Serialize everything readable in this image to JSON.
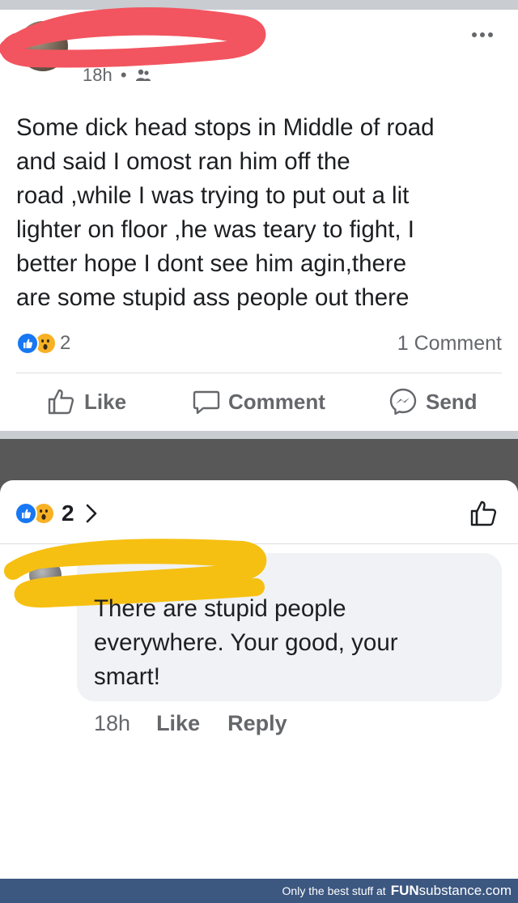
{
  "post": {
    "timestamp": "18h",
    "separator": "•",
    "text_lines": [
      "Some dick head stops in Middle of road",
      "and said I omost ran him off the",
      "road ,while I was trying to put out a lit",
      "lighter on floor ,he was teary to fight, I",
      "better hope I dont see him agin,there",
      "are some stupid ass people out there"
    ],
    "reaction_count": "2",
    "comment_count": "1 Comment",
    "actions": {
      "like": "Like",
      "comment": "Comment",
      "send": "Send"
    },
    "icons": [
      "friends-icon",
      "more-icon",
      "like-icon",
      "comment-icon",
      "messenger-icon"
    ]
  },
  "comments_sheet": {
    "reaction_count": "2",
    "icons": [
      "like-reaction-icon",
      "wow-reaction-icon",
      "chevron-right-icon",
      "like-icon"
    ]
  },
  "comment": {
    "text_lines": [
      "There are stupid people",
      "everywhere. Your good, your",
      "smart!"
    ],
    "time": "18h",
    "like_label": "Like",
    "reply_label": "Reply"
  },
  "footer": {
    "tagline": "Only the best stuff at",
    "brand_bold": "FUN",
    "brand_rest": "substance.com"
  },
  "colors": {
    "facebook_blue": "#1877f2",
    "wow_yellow": "#f7b125",
    "redaction_red": "#f2555f",
    "redaction_yellow": "#f6c012",
    "footer_bg": "#3c5780"
  }
}
